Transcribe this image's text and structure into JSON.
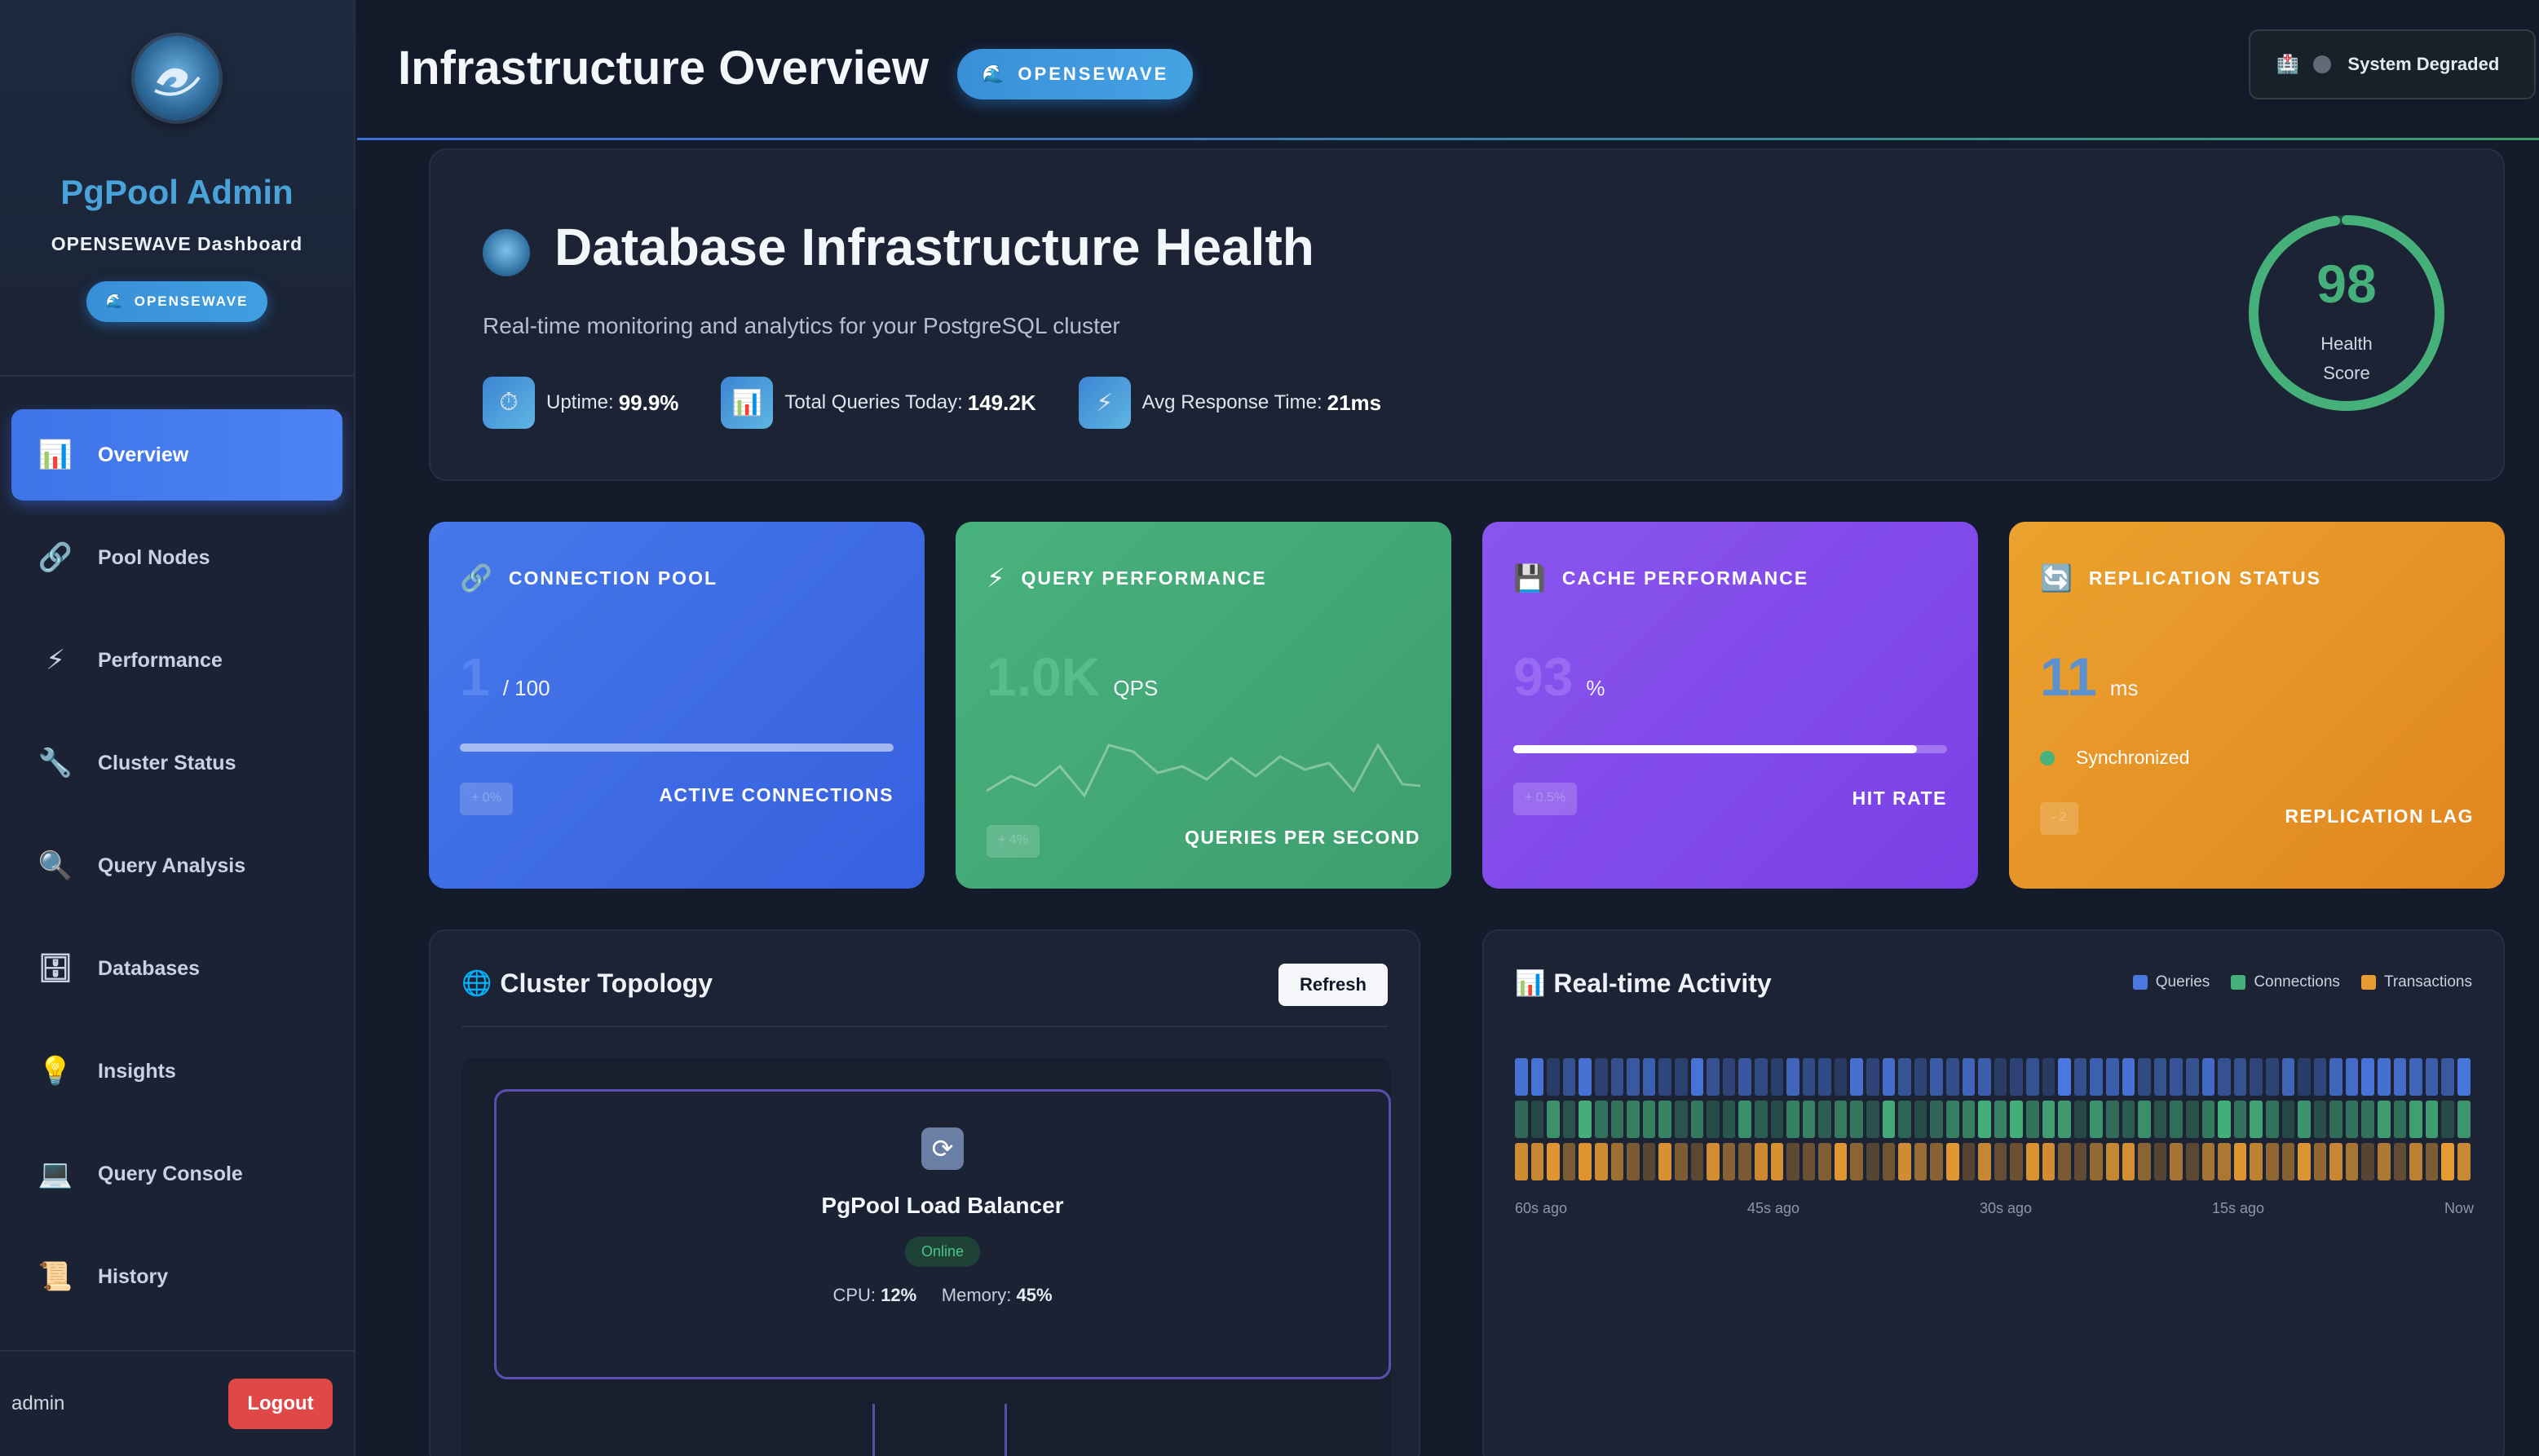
{
  "sidebar": {
    "title": "PgPool Admin",
    "subtitle": "OPENSEWAVE Dashboard",
    "pill": "OPENSEWAVE",
    "items": [
      {
        "label": "Overview",
        "icon": "📊",
        "icon_name": "chart-icon"
      },
      {
        "label": "Pool Nodes",
        "icon": "🔗",
        "icon_name": "link-icon"
      },
      {
        "label": "Performance",
        "icon": "⚡",
        "icon_name": "lightning-icon"
      },
      {
        "label": "Cluster Status",
        "icon": "🔧",
        "icon_name": "wrench-icon"
      },
      {
        "label": "Query Analysis",
        "icon": "🔍",
        "icon_name": "magnifier-icon"
      },
      {
        "label": "Databases",
        "icon": "🗄",
        "icon_name": "cabinet-icon"
      },
      {
        "label": "Insights",
        "icon": "💡",
        "icon_name": "lightbulb-icon"
      },
      {
        "label": "Query Console",
        "icon": "💻",
        "icon_name": "laptop-icon"
      },
      {
        "label": "History",
        "icon": "📜",
        "icon_name": "scroll-icon"
      }
    ],
    "active_index": 0,
    "user": "admin",
    "logout": "Logout"
  },
  "header": {
    "title": "Infrastructure Overview",
    "pill": "OPENSEWAVE",
    "status": "System Degraded"
  },
  "hero": {
    "title": "Database Infrastructure Health",
    "description": "Real-time monitoring and analytics for your PostgreSQL cluster",
    "stats": [
      {
        "label": "Uptime:",
        "value": "99.9%",
        "icon": "⏱",
        "icon_name": "stopwatch-icon"
      },
      {
        "label": "Total Queries Today:",
        "value": "149.2K",
        "icon": "📊",
        "icon_name": "chart-icon"
      },
      {
        "label": "Avg Response Time:",
        "value": "21ms",
        "icon": "⚡",
        "icon_name": "lightning-icon"
      }
    ],
    "health_score": "98",
    "health_label_line1": "Health",
    "health_label_line2": "Score",
    "health_fraction": 0.98
  },
  "cards": {
    "pool": {
      "title": "CONNECTION POOL",
      "value": "1",
      "unit": "/ 100",
      "footer": "ACTIVE CONNECTIONS",
      "progress": 1.0,
      "badge": "+ 0%"
    },
    "query": {
      "title": "QUERY PERFORMANCE",
      "value": "1.0K",
      "unit": "QPS",
      "footer": "QUERIES PER SECOND",
      "badge": "+ 4%"
    },
    "cache": {
      "title": "CACHE PERFORMANCE",
      "value": "93",
      "unit": "%",
      "footer": "HIT RATE",
      "progress": 0.93,
      "badge": "+ 0.5%"
    },
    "replication": {
      "title": "REPLICATION STATUS",
      "value": "11",
      "unit": "ms",
      "status": "Synchronized",
      "footer": "REPLICATION LAG",
      "badge": "- 2"
    }
  },
  "topology": {
    "title": "Cluster Topology",
    "refresh": "Refresh",
    "lb_title": "PgPool Load Balancer",
    "lb_status": "Online",
    "cpu_label": "CPU:",
    "cpu_value": "12%",
    "mem_label": "Memory:",
    "mem_value": "45%"
  },
  "activity": {
    "title": "Real-time Activity",
    "legend": [
      "Queries",
      "Connections",
      "Transactions"
    ],
    "colors": {
      "queries": "#4a78e0",
      "connections": "#45b07a",
      "transactions": "#e89b32"
    },
    "time_labels": [
      "60s ago",
      "45s ago",
      "30s ago",
      "15s ago",
      "Now"
    ]
  },
  "colors": {
    "accent": "#4a7cf0",
    "health": "#45b07a",
    "logout": "#e04848"
  }
}
